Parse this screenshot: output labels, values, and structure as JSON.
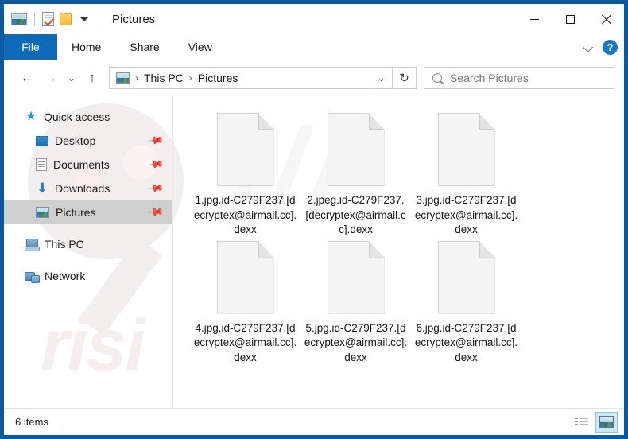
{
  "window": {
    "title": "Pictures",
    "quick_access": [
      {
        "name": "pictures-icon",
        "label": "Pictures"
      },
      {
        "name": "properties-icon",
        "label": "Properties"
      },
      {
        "name": "new-folder-icon",
        "label": "New folder"
      }
    ],
    "controls": {
      "minimize": "—",
      "maximize": "□",
      "close": "×"
    }
  },
  "ribbon": {
    "tabs": [
      {
        "label": "File",
        "selected": true
      },
      {
        "label": "Home",
        "selected": false
      },
      {
        "label": "Share",
        "selected": false
      },
      {
        "label": "View",
        "selected": false
      }
    ],
    "collapse_label": "⌄",
    "help_label": "?"
  },
  "navigation": {
    "back": "←",
    "forward": "→",
    "recent": "⌄",
    "up": "↑",
    "breadcrumb": {
      "root_icon": "pictures-icon",
      "items": [
        "This PC",
        "Pictures"
      ],
      "separator": "›",
      "dropdown": "⌄"
    },
    "refresh": "↻"
  },
  "search": {
    "placeholder": "Search Pictures",
    "value": ""
  },
  "sidebar": {
    "items": [
      {
        "label": "Quick access",
        "icon": "star-icon",
        "level": 1,
        "pinned": false,
        "selected": false
      },
      {
        "label": "Desktop",
        "icon": "desktop-icon",
        "level": 2,
        "pinned": true,
        "selected": false
      },
      {
        "label": "Documents",
        "icon": "documents-icon",
        "level": 2,
        "pinned": true,
        "selected": false
      },
      {
        "label": "Downloads",
        "icon": "downloads-icon",
        "level": 2,
        "pinned": true,
        "selected": false
      },
      {
        "label": "Pictures",
        "icon": "pictures-icon",
        "level": 2,
        "pinned": true,
        "selected": true
      },
      {
        "label": "This PC",
        "icon": "this-pc-icon",
        "level": 1,
        "pinned": false,
        "selected": false
      },
      {
        "label": "Network",
        "icon": "network-icon",
        "level": 1,
        "pinned": false,
        "selected": false
      }
    ],
    "pin_glyph": "✒"
  },
  "files": [
    {
      "name": "1.jpg.id-C279F237.[decryptex@airmail.cc].dexx"
    },
    {
      "name": "2.jpeg.id-C279F237.[decryptex@airmail.cc].dexx"
    },
    {
      "name": "3.jpg.id-C279F237.[decryptex@airmail.cc].dexx"
    },
    {
      "name": "4.jpg.id-C279F237.[decryptex@airmail.cc].dexx"
    },
    {
      "name": "5.jpg.id-C279F237.[decryptex@airmail.cc].dexx"
    },
    {
      "name": "6.jpg.id-C279F237.[decryptex@airmail.cc].dexx"
    }
  ],
  "statusbar": {
    "item_count": "6 items",
    "views": [
      {
        "name": "details-view",
        "active": false
      },
      {
        "name": "large-icons-view",
        "active": true
      }
    ]
  },
  "watermark": {
    "text": "risi",
    "slashes": "///"
  },
  "colors": {
    "accent": "#0d6ab8",
    "frame": "#0a5aa0",
    "selection": "#cfcfcf",
    "view_active": "#cde8f7"
  }
}
